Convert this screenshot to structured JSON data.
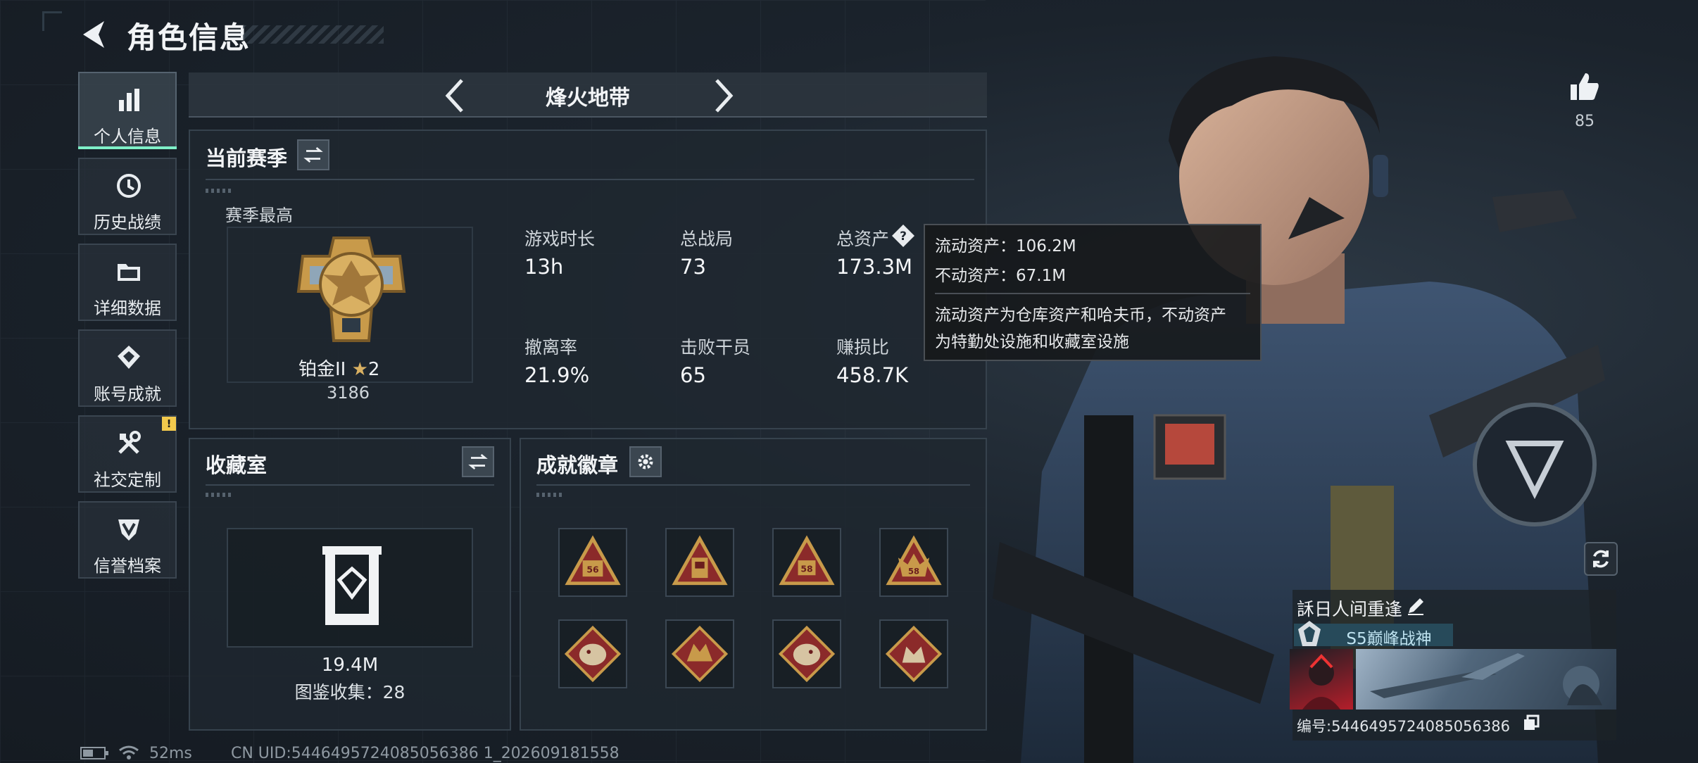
{
  "header": {
    "title": "角色信息"
  },
  "sidebar": {
    "items": [
      {
        "label": "个人信息",
        "icon": "bar-chart-icon",
        "active": true
      },
      {
        "label": "历史战绩",
        "icon": "history-clock-icon"
      },
      {
        "label": "详细数据",
        "icon": "folder-icon"
      },
      {
        "label": "账号成就",
        "icon": "achievement-icon"
      },
      {
        "label": "社交定制",
        "icon": "tools-icon",
        "alert": "!"
      },
      {
        "label": "信誉档案",
        "icon": "reputation-icon"
      }
    ]
  },
  "mode_tab": {
    "title": "烽火地带"
  },
  "season": {
    "title": "当前赛季",
    "best_label": "赛季最高",
    "rank_name": "铂金II",
    "rank_stars": "2",
    "rank_score": "3186",
    "stats": [
      {
        "label": "游戏时长",
        "value": "13h"
      },
      {
        "label": "总战局",
        "value": "73"
      },
      {
        "label": "总资产",
        "value": "173.3M"
      },
      {
        "label": "撤离率",
        "value": "21.9%"
      },
      {
        "label": "击败干员",
        "value": "65"
      },
      {
        "label": "赚损比",
        "value": "458.7K"
      }
    ]
  },
  "tooltip": {
    "liquid": "流动资产：106.2M",
    "fixed": "不动资产：67.1M",
    "note1": "流动资产为仓库资产和哈夫币，不动资产",
    "note2": "为特勤处设施和收藏室设施"
  },
  "collection": {
    "title": "收藏室",
    "value": "19.4M",
    "count_text": "图鉴收集：28"
  },
  "badges": {
    "title": "成就徽章",
    "numbers": [
      "56",
      "",
      "58",
      "58"
    ]
  },
  "player": {
    "name": "訸日人间重逢",
    "title_badge": "S5巅峰战神",
    "id_text": "编号:5446495724085056386"
  },
  "likes": {
    "count": "85"
  },
  "status_bar": {
    "ping": "52ms",
    "uid_text": "CN UID:5446495724085056386 1_202609181558"
  },
  "colors": {
    "accent": "#7ef0c8",
    "panel": "#1f2730",
    "gold": "#c89a4a",
    "badge_red": "#8b2a2a",
    "title_bar": "#274a5a"
  }
}
